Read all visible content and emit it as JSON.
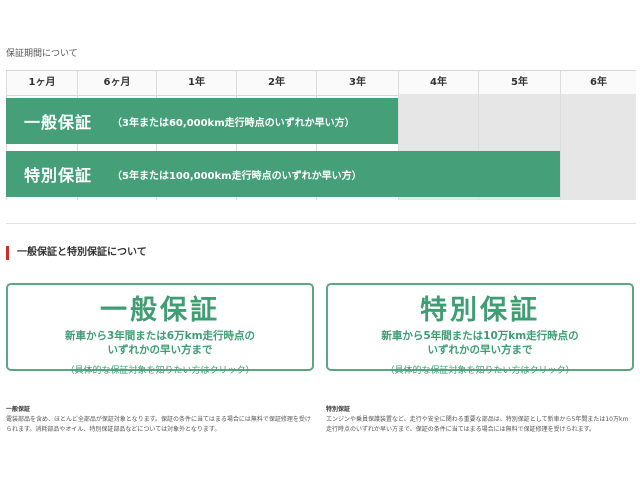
{
  "page": {
    "heading": "保証期間について"
  },
  "timeline": {
    "columns": [
      "1ヶ月",
      "6ヶ月",
      "1年",
      "2年",
      "3年",
      "4年",
      "5年",
      "6年"
    ],
    "bars": [
      {
        "title": "一般保証",
        "note": "（3年または60,000km走行時点のいずれか早い方）",
        "color": "#45a07a"
      },
      {
        "title": "特別保証",
        "note": "（5年または100,000km走行時点のいずれか早い方）",
        "color": "#45a07a"
      }
    ]
  },
  "section": {
    "title": "一般保証と特別保証について",
    "accent": "#c8302c"
  },
  "cards": [
    {
      "title": "一般保証",
      "desc_line1": "新車から3年間または6万km走行時点の",
      "desc_line2": "いずれかの早い方まで",
      "link": "（具体的な保証対象を知りたい方はクリック）"
    },
    {
      "title": "特別保証",
      "desc_line1": "新車から5年間または10万km走行時点の",
      "desc_line2": "いずれかの早い方まで",
      "link": "（具体的な保証対象を知りたい方はクリック）"
    }
  ],
  "notes": [
    {
      "title": "一般保証",
      "text": "電装部品を含め、ほとんど全部品が保証対象となります。保証の条件に当てはまる場合には無料で保証修理を受けられます。消耗部品やオイル、特別保証部品などについては対象外となります。"
    },
    {
      "title": "特別保証",
      "text": "エンジンや乗員保護装置など、走行や安全に関わる重要な部品は、特別保証として新車から5年間または10万km走行時点のいずれか早い方まで、保証の条件に当てはまる場合には無料で保証修理を受けられます。"
    }
  ]
}
